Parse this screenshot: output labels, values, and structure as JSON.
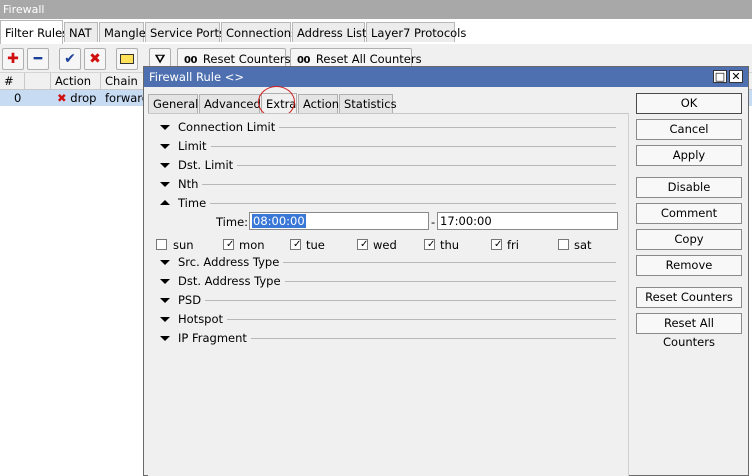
{
  "main": {
    "title": "Firewall",
    "tabs": [
      "Filter Rules",
      "NAT",
      "Mangle",
      "Service Ports",
      "Connections",
      "Address Lists",
      "Layer7 Protocols"
    ],
    "toolbar": {
      "reset_counters": "Reset Counters",
      "reset_all_counters": "Reset All Counters",
      "counter_glyph": "00"
    },
    "table": {
      "columns": [
        "#",
        "Action",
        "Chain"
      ],
      "row": {
        "num": "0",
        "action": "drop",
        "chain": "forward"
      }
    }
  },
  "dialog": {
    "title": "Firewall Rule <>",
    "tabs": [
      "General",
      "Advanced",
      "Extra",
      "Action",
      "Statistics"
    ],
    "sections_top": [
      "Connection Limit",
      "Limit",
      "Dst. Limit",
      "Nth"
    ],
    "time": {
      "label": "Time",
      "field_label": "Time:",
      "from": "08:00:00",
      "separator": "-",
      "to": "17:00:00",
      "days": [
        {
          "name": "sun",
          "checked": false
        },
        {
          "name": "mon",
          "checked": true
        },
        {
          "name": "tue",
          "checked": true
        },
        {
          "name": "wed",
          "checked": true
        },
        {
          "name": "thu",
          "checked": true
        },
        {
          "name": "fri",
          "checked": true
        },
        {
          "name": "sat",
          "checked": false
        }
      ]
    },
    "sections_bottom": [
      "Src. Address Type",
      "Dst. Address Type",
      "PSD",
      "Hotspot",
      "IP Fragment"
    ],
    "buttons": [
      "OK",
      "Cancel",
      "Apply",
      "Disable",
      "Comment",
      "Copy",
      "Remove",
      "Reset Counters",
      "Reset All Counters"
    ]
  }
}
